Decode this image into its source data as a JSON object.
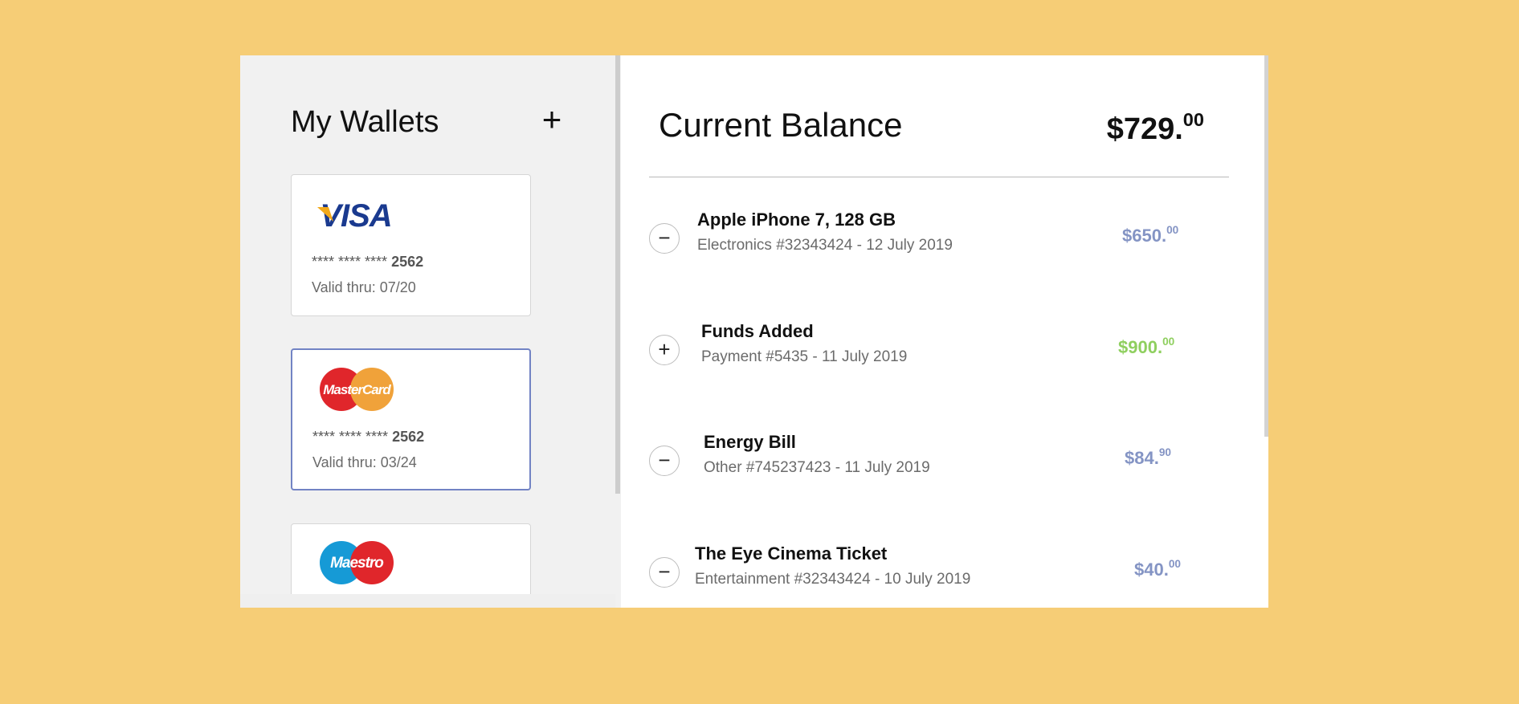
{
  "wallets": {
    "title": "My Wallets",
    "add_label": "+",
    "cards": [
      {
        "brand": "VISA",
        "number_mask": "**** **** ****",
        "last4": "2562",
        "valid": "Valid thru: 07/20",
        "selected": false
      },
      {
        "brand": "MasterCard",
        "number_mask": "**** **** ****",
        "last4": "2562",
        "valid": "Valid thru: 03/24",
        "selected": true
      },
      {
        "brand": "Maestro",
        "number_mask": "",
        "last4": "",
        "valid": "",
        "selected": false
      }
    ]
  },
  "balance": {
    "title": "Current Balance",
    "amount_main": "$729.",
    "amount_cents": "00"
  },
  "transactions": [
    {
      "sign": "−",
      "title": "Apple iPhone 7, 128 GB",
      "subtitle": "Electronics #32343424 - 12 July 2019",
      "amount_main": "$650.",
      "amount_cents": "00",
      "type": "debit"
    },
    {
      "sign": "+",
      "title": "Funds Added",
      "subtitle": "Payment #5435 - 11 July 2019",
      "amount_main": "$900.",
      "amount_cents": "00",
      "type": "credit"
    },
    {
      "sign": "−",
      "title": "Energy Bill",
      "subtitle": "Other #745237423 - 11 July 2019",
      "amount_main": "$84.",
      "amount_cents": "90",
      "type": "debit"
    },
    {
      "sign": "−",
      "title": "The Eye Cinema Ticket",
      "subtitle": "Entertainment #32343424 - 10 July 2019",
      "amount_main": "$40.",
      "amount_cents": "00",
      "type": "debit"
    }
  ],
  "colors": {
    "background": "#f6cd76",
    "debit_amount": "#8494c4",
    "credit_amount": "#8fcf5f",
    "selected_card_border": "#7283c4",
    "visa_blue": "#1a3a8f",
    "visa_gold": "#f2a91a",
    "mastercard_red": "#e0262b",
    "mastercard_orange": "#f0a23a",
    "maestro_blue": "#169ad6"
  }
}
